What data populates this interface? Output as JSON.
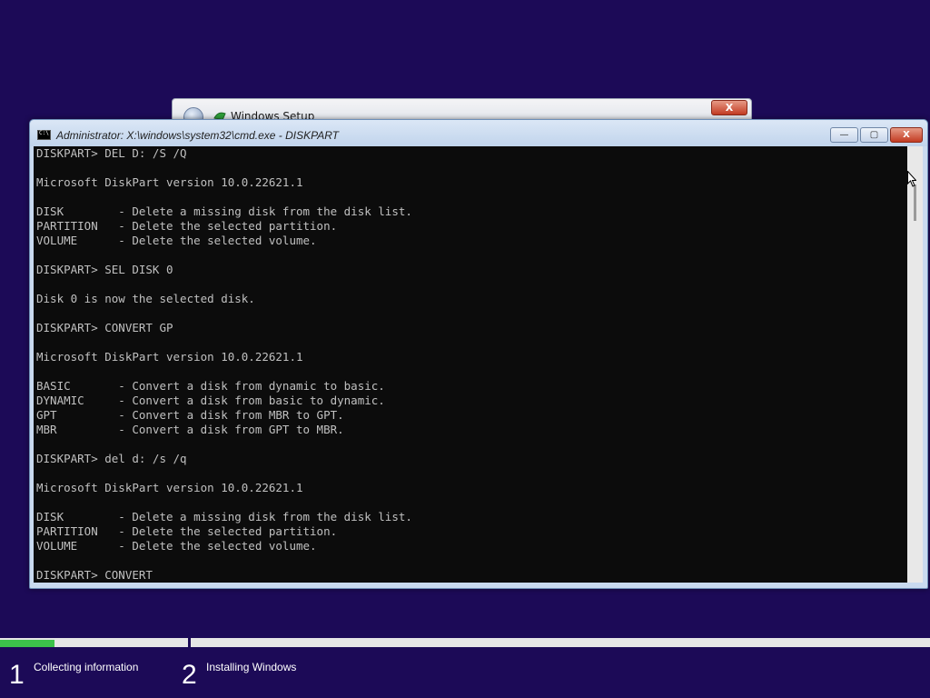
{
  "setup_window": {
    "title": "Windows Setup",
    "close_label": "X"
  },
  "cmd_window": {
    "title": "Administrator: X:\\windows\\system32\\cmd.exe - DISKPART",
    "minimize_label": "—",
    "maximize_label": "▢",
    "close_label": "X"
  },
  "console": {
    "lines": [
      "DISKPART> DEL D: /S /Q",
      "",
      "Microsoft DiskPart version 10.0.22621.1",
      "",
      "DISK        - Delete a missing disk from the disk list.",
      "PARTITION   - Delete the selected partition.",
      "VOLUME      - Delete the selected volume.",
      "",
      "DISKPART> SEL DISK 0",
      "",
      "Disk 0 is now the selected disk.",
      "",
      "DISKPART> CONVERT GP",
      "",
      "Microsoft DiskPart version 10.0.22621.1",
      "",
      "BASIC       - Convert a disk from dynamic to basic.",
      "DYNAMIC     - Convert a disk from basic to dynamic.",
      "GPT         - Convert a disk from MBR to GPT.",
      "MBR         - Convert a disk from GPT to MBR.",
      "",
      "DISKPART> del d: /s /q",
      "",
      "Microsoft DiskPart version 10.0.22621.1",
      "",
      "DISK        - Delete a missing disk from the disk list.",
      "PARTITION   - Delete the selected partition.",
      "VOLUME      - Delete the selected volume.",
      "",
      "DISKPART> CONVERT"
    ]
  },
  "progress": {
    "step1_fraction": 0.29
  },
  "steps": [
    {
      "number": "1",
      "label": "Collecting information"
    },
    {
      "number": "2",
      "label": "Installing Windows"
    }
  ],
  "colors": {
    "desktop": "#1c0a57",
    "console_bg": "#0c0c0c",
    "console_text": "#c0c0c0",
    "progress_fill": "#3cc24a"
  }
}
